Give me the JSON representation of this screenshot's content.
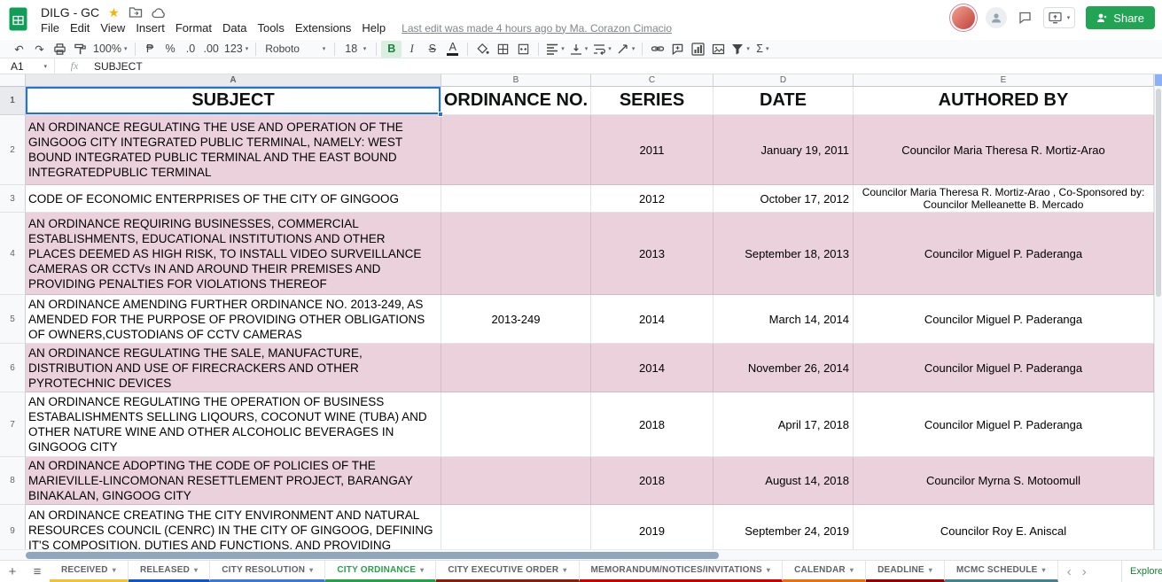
{
  "colors": {
    "row_shade": "#ead1dc",
    "selection_blue": "#1a73e8",
    "share_green": "#23a455",
    "logo_green": "#0f9d58",
    "star_orange": "#f5b400"
  },
  "titlebar": {
    "title": "DILG - GC",
    "share_label": "Share"
  },
  "menubar": {
    "items": [
      "File",
      "Edit",
      "View",
      "Insert",
      "Format",
      "Data",
      "Tools",
      "Extensions",
      "Help"
    ],
    "last_edit": "Last edit was made 4 hours ago by Ma. Corazon Cimacio"
  },
  "toolbar": {
    "zoom": "100%",
    "currency": "₱",
    "percent": "%",
    "decrease_decimal": ".0",
    "increase_decimal": ".00",
    "more_formats": "123",
    "font": "Roboto",
    "font_size": "18",
    "bold": "B",
    "italic": "I",
    "strikethrough": "S",
    "text_color": "A",
    "functions": "Σ"
  },
  "formula_bar": {
    "cell_ref": "A1",
    "fx_label": "fx",
    "value": "SUBJECT"
  },
  "grid": {
    "col_letters": [
      "A",
      "B",
      "C",
      "D",
      "E"
    ],
    "header_row": {
      "num": "1",
      "cells": [
        "SUBJECT",
        "ORDINANCE NO.",
        "SERIES",
        "DATE",
        "AUTHORED BY"
      ]
    },
    "rows": [
      {
        "num": "2",
        "shaded": true,
        "subject": "AN ORDINANCE REGULATING THE USE AND OPERATION OF THE GINGOOG CITY INTEGRATED PUBLIC TERMINAL, NAMELY: WEST BOUND INTEGRATED PUBLIC TERMINAL AND THE EAST BOUND INTEGRATEDPUBLIC TERMINAL",
        "ordinance_no": "",
        "series": "2011",
        "date": "January 19, 2011",
        "authored_by": "Councilor Maria Theresa R. Mortiz-Arao"
      },
      {
        "num": "3",
        "shaded": false,
        "subject": "CODE OF ECONOMIC ENTERPRISES OF THE CITY OF GINGOOG",
        "ordinance_no": "",
        "series": "2012",
        "date": "October 17, 2012",
        "authored_by": "Councilor Maria Theresa R. Mortiz-Arao , Co-Sponsored by: Councilor Melleanette B. Mercado"
      },
      {
        "num": "4",
        "shaded": true,
        "subject": "AN ORDINANCE REQUIRING BUSINESSES, COMMERCIAL ESTABLISHMENTS, EDUCATIONAL INSTITUTIONS AND OTHER PLACES DEEMED AS HIGH RISK, TO INSTALL VIDEO SURVEILLANCE CAMERAS OR CCTVs IN AND AROUND THEIR PREMISES AND PROVIDING PENALTIES FOR VIOLATIONS THEREOF",
        "ordinance_no": "",
        "series": "2013",
        "date": "September 18, 2013",
        "authored_by": "Councilor Miguel P. Paderanga"
      },
      {
        "num": "5",
        "shaded": false,
        "subject": "AN ORDINANCE AMENDING FURTHER ORDINANCE NO. 2013-249, AS AMENDED FOR THE PURPOSE OF PROVIDING OTHER OBLIGATIONS OF OWNERS,CUSTODIANS OF CCTV CAMERAS",
        "ordinance_no": "2013-249",
        "series": "2014",
        "date": "March 14, 2014",
        "authored_by": "Councilor Miguel P. Paderanga"
      },
      {
        "num": "6",
        "shaded": true,
        "subject": "AN ORDINANCE REGULATING THE SALE, MANUFACTURE, DISTRIBUTION AND USE OF FIRECRACKERS AND OTHER PYROTECHNIC DEVICES",
        "ordinance_no": "",
        "series": "2014",
        "date": "November 26, 2014",
        "authored_by": "Councilor Miguel P. Paderanga"
      },
      {
        "num": "7",
        "shaded": false,
        "subject": "AN ORDINANCE REGULATING THE OPERATION OF BUSINESS ESTABALISHMENTS SELLING LIQOURS, COCONUT WINE (TUBA) AND OTHER NATURE WINE AND OTHER ALCOHOLIC BEVERAGES IN GINGOOG CITY",
        "ordinance_no": "",
        "series": "2018",
        "date": "April 17, 2018",
        "authored_by": "Councilor Miguel P. Paderanga"
      },
      {
        "num": "8",
        "shaded": true,
        "subject": "AN ORDINANCE ADOPTING THE CODE OF POLICIES OF THE MARIEVILLE-LINCOMONAN RESETTLEMENT PROJECT, BARANGAY BINAKALAN, GINGOOG CITY",
        "ordinance_no": "",
        "series": "2018",
        "date": "August 14, 2018",
        "authored_by": "Councilor Myrna S. Motoomull"
      },
      {
        "num": "9",
        "shaded": false,
        "subject": "AN ORDINANCE CREATING THE CITY ENVIRONMENT AND NATURAL RESOURCES COUNCIL (CENRC) IN THE CITY OF GINGOOG, DEFINING IT'S COMPOSITION, DUTIES AND FUNCTIONS, AND PROVIDING FUNDS",
        "ordinance_no": "",
        "series": "2019",
        "date": "September 24, 2019",
        "authored_by": "Councilor Roy E. Aniscal"
      }
    ]
  },
  "sheet_tabs": {
    "tabs": [
      {
        "label": "RECEIVED",
        "color": "#f1c232",
        "active": false
      },
      {
        "label": "RELEASED",
        "color": "#1155cc",
        "active": false
      },
      {
        "label": "CITY RESOLUTION",
        "color": "#3c78d8",
        "active": false
      },
      {
        "label": "CITY ORDINANCE",
        "color": "#27a04b",
        "active": true
      },
      {
        "label": "CITY EXECUTIVE ORDER",
        "color": "#85200c",
        "active": false
      },
      {
        "label": "MEMORANDUM/NOTICES/INVITATIONS",
        "color": "#cc0000",
        "active": false
      },
      {
        "label": "CALENDAR",
        "color": "#e8710a",
        "active": false
      },
      {
        "label": "DEADLINE",
        "color": "#990000",
        "active": false
      },
      {
        "label": "MCMC SCHEDULE",
        "color": "#45818e",
        "active": false
      }
    ],
    "explore_label": "Explore"
  }
}
